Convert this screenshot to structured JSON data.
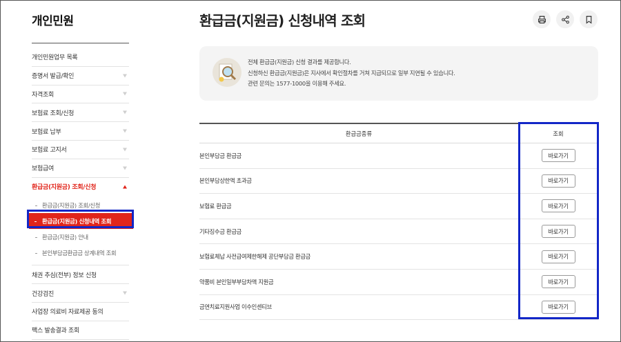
{
  "sidebar": {
    "title": "개인민원",
    "items": [
      {
        "label": "개인민원업무 목록",
        "chevron": false
      },
      {
        "label": "증명서 발급/확인",
        "chevron": true
      },
      {
        "label": "자격조회",
        "chevron": true
      },
      {
        "label": "보험료 조회/신청",
        "chevron": true
      },
      {
        "label": "보험료 납부",
        "chevron": true
      },
      {
        "label": "보험료 고지서",
        "chevron": true
      },
      {
        "label": "보험급여",
        "chevron": true
      },
      {
        "label": "환급금(지원금) 조회/신청",
        "chevron": true,
        "active": true
      }
    ],
    "subitems": [
      {
        "label": "환급금(지원금) 조회/신청"
      },
      {
        "label": "환급금(지원금) 신청내역 조회",
        "selected": true
      },
      {
        "label": "환급금(지원금) 안내"
      },
      {
        "label": "본인부담금환급금 상계내역 조회"
      }
    ],
    "items_after": [
      {
        "label": "채권 추심(전부) 정보 신청",
        "chevron": false
      },
      {
        "label": "건강검진",
        "chevron": true
      },
      {
        "label": "사업장 의료비 자료제공 동의",
        "chevron": false
      },
      {
        "label": "팩스 발송결과 조회",
        "chevron": false
      }
    ]
  },
  "main": {
    "title": "환급금(지원금) 신청내역 조회",
    "tools": [
      "printer-icon",
      "share-icon",
      "bookmark-icon"
    ],
    "info_lines": [
      "전체 환급금(지원금) 신청 결과를 제공합니다.",
      "신청하신 환급금(지원금)은 지사에서 확인절차를 거쳐 지급되므로 일부 지연될 수 있습니다.",
      "관련 문의는 1577-1000을 이용해 주세요."
    ],
    "table": {
      "col_type": "환급금종류",
      "col_view": "조회",
      "button_label": "바로가기",
      "rows": [
        "본인부담금 환급금",
        "본인부담상한액 초과금",
        "보험료 환급금",
        "기타징수금 환급금",
        "보험료체납 사전급여제한해제 공단부담금 환급금",
        "약품비 본인일부부담차액 지원금",
        "금연치료지원사업 이수인센티브"
      ]
    }
  },
  "colors": {
    "accent": "#e1251b",
    "highlight": "#1226c7"
  }
}
